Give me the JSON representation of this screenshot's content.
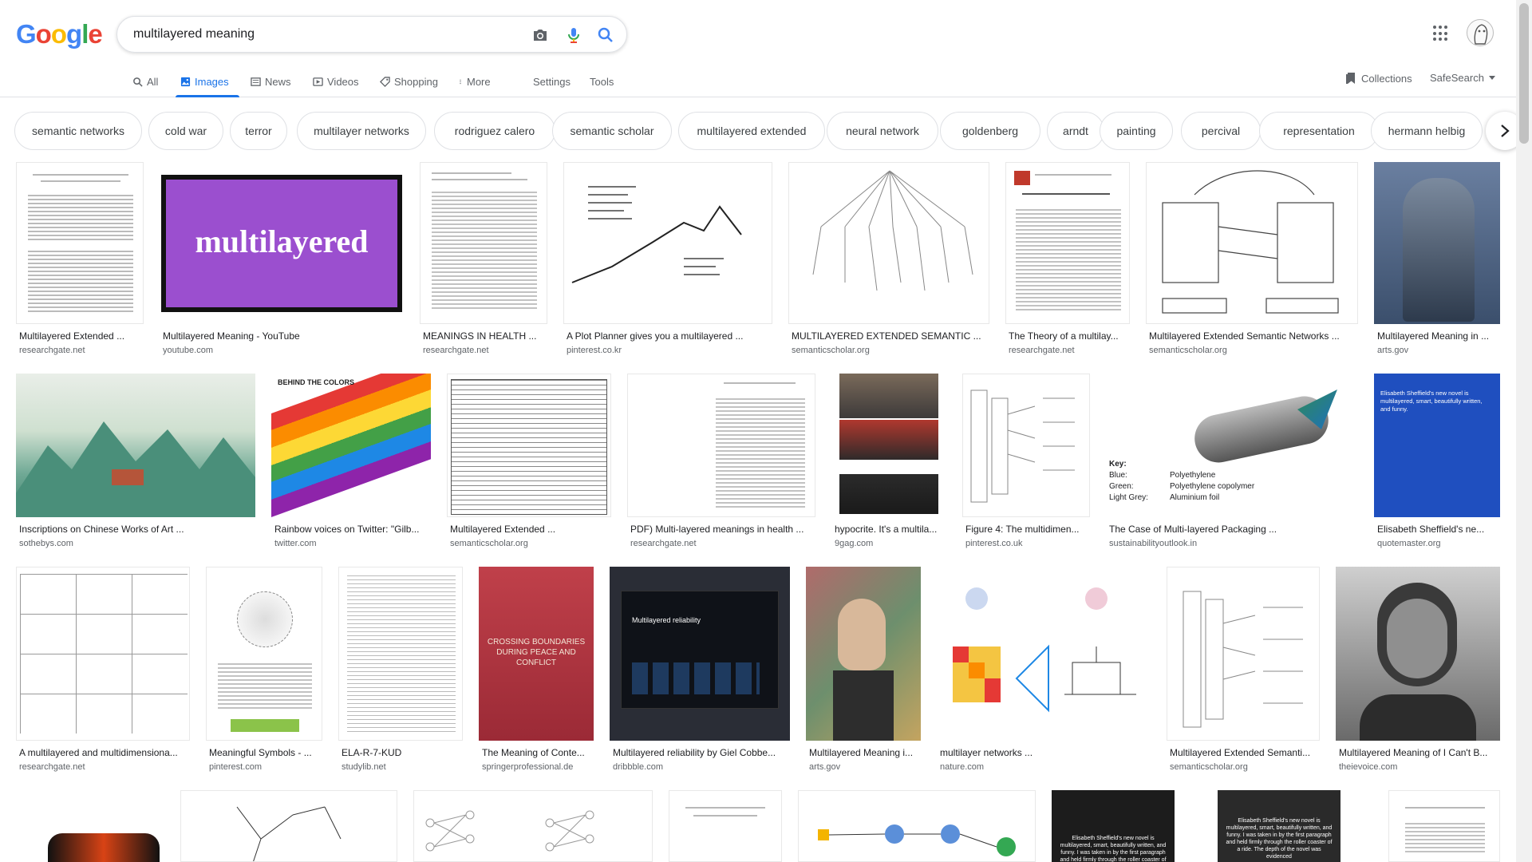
{
  "logo": [
    "G",
    "o",
    "o",
    "g",
    "l",
    "e"
  ],
  "logo_colors": [
    "#4285f4",
    "#ea4335",
    "#fbbc05",
    "#4285f4",
    "#34a853",
    "#ea4335"
  ],
  "search": {
    "query": "multilayered meaning"
  },
  "tabs": {
    "all": "All",
    "images": "Images",
    "news": "News",
    "videos": "Videos",
    "shopping": "Shopping",
    "more": "More",
    "settings": "Settings",
    "tools": "Tools"
  },
  "right": {
    "collections": "Collections",
    "safesearch": "SafeSearch"
  },
  "chips": [
    "semantic networks",
    "cold war",
    "terror",
    "multilayer networks",
    "rodriguez calero",
    "semantic scholar",
    "multilayered extended",
    "neural network",
    "goldenberg",
    "arndt",
    "painting",
    "percival",
    "representation",
    "hermann helbig"
  ],
  "thumb_text": {
    "purple_word": "multilayered",
    "rainbow_heading": "BEHIND THE COLORS",
    "blue_quote": "Elisabeth Sheffield's new novel is multilayered, smart, beautifully written, and funny.",
    "dark_heading": "Multilayered reliability",
    "red_book": "CROSSING BOUNDARIES DURING PEACE AND CONFLICT",
    "packaging_key": "Key:",
    "packaging_blue": "Blue:",
    "packaging_green": "Green:",
    "packaging_grey": "Light Grey:",
    "packaging_poly1": "Polyethylene",
    "packaging_poly2": "Polyethylene copolymer",
    "packaging_foil": "Aluminium foil",
    "row4_quote": "Elisabeth Sheffield's new novel is multilayered, smart, beautifully written, and funny. I was taken in by the first paragraph and held firmly through the roller coaster of a ride. The depth of the novel was evidenced"
  },
  "results": {
    "r1": [
      {
        "title": "Multilayered Extended ...",
        "src": "researchgate.net"
      },
      {
        "title": "Multilayered Meaning - YouTube",
        "src": "youtube.com"
      },
      {
        "title": "MEANINGS IN HEALTH ...",
        "src": "researchgate.net"
      },
      {
        "title": "A Plot Planner gives you a multilayered ...",
        "src": "pinterest.co.kr"
      },
      {
        "title": "MULTILAYERED EXTENDED SEMANTIC ...",
        "src": "semanticscholar.org"
      },
      {
        "title": "The Theory of a multilay...",
        "src": "researchgate.net"
      },
      {
        "title": "Multilayered Extended Semantic Networks ...",
        "src": "semanticscholar.org"
      },
      {
        "title": "Multilayered Meaning in ...",
        "src": "arts.gov"
      }
    ],
    "r2": [
      {
        "title": "Inscriptions on Chinese Works of Art ...",
        "src": "sothebys.com"
      },
      {
        "title": "Rainbow voices on Twitter: \"Gilb...",
        "src": "twitter.com"
      },
      {
        "title": "Multilayered Extended ...",
        "src": "semanticscholar.org"
      },
      {
        "title": "PDF) Multi-layered meanings in health ...",
        "src": "researchgate.net"
      },
      {
        "title": "hypocrite. It's a multila...",
        "src": "9gag.com"
      },
      {
        "title": "Figure 4: The multidimen...",
        "src": "pinterest.co.uk"
      },
      {
        "title": "The Case of Multi-layered Packaging ...",
        "src": "sustainabilityoutlook.in"
      },
      {
        "title": "Elisabeth Sheffield's ne...",
        "src": "quotemaster.org"
      }
    ],
    "r3": [
      {
        "title": "A multilayered and multidimensiona...",
        "src": "researchgate.net"
      },
      {
        "title": "Meaningful Symbols - ...",
        "src": "pinterest.com"
      },
      {
        "title": "ELA-R-7-KUD",
        "src": "studylib.net"
      },
      {
        "title": "The Meaning of Conte...",
        "src": "springerprofessional.de"
      },
      {
        "title": "Multilayered reliability by Giel Cobbe...",
        "src": "dribbble.com"
      },
      {
        "title": "Multilayered Meaning i...",
        "src": "arts.gov"
      },
      {
        "title": "multilayer networks ...",
        "src": "nature.com"
      },
      {
        "title": "Multilayered Extended Semanti...",
        "src": "semanticscholar.org"
      },
      {
        "title": "Multilayered Meaning of I Can't B...",
        "src": "theievoice.com"
      }
    ]
  }
}
